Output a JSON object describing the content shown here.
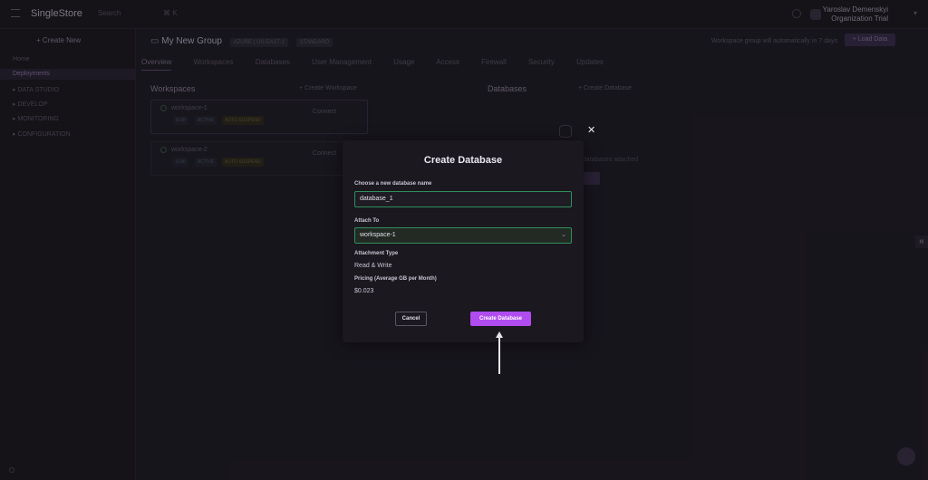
{
  "topbar": {
    "logo": "SingleStore",
    "search": "Search",
    "shortcut": "⌘ K",
    "user_name": "Yaroslav Demenskyi",
    "user_org": "Organization Trial"
  },
  "sidebar": {
    "create_new": "+ Create New",
    "items": [
      {
        "label": "Home"
      },
      {
        "label": "Deployments"
      },
      {
        "label": "▸ DATA STUDIO"
      },
      {
        "label": "▸ DEVELOP"
      },
      {
        "label": "▸ MONITORING"
      },
      {
        "label": "▸ CONFIGURATION"
      }
    ]
  },
  "main": {
    "group_title": "My New Group",
    "badges": [
      "AZURE | US-EAST-1",
      "STANDARD"
    ],
    "notice": "Workspace group will automatically in 7 days",
    "load_data": "+ Load Data",
    "tabs": [
      "Overview",
      "Workspaces",
      "Databases",
      "User Management",
      "Usage",
      "Access",
      "Firewall",
      "Security",
      "Updates"
    ],
    "workspaces_heading": "Workspaces",
    "create_workspace": "+ Create Workspace",
    "databases_heading": "Databases",
    "create_database_link": "+ Create Database",
    "workspace_cards": [
      {
        "name": "workspace-1",
        "chips": [
          "S-00",
          "ACTIVE",
          "AUTO-SUSPEND"
        ],
        "connect": "Connect"
      },
      {
        "name": "workspace-2",
        "chips": [
          "S-00",
          "ACTIVE",
          "AUTO-SUSPEND"
        ],
        "connect": "Connect"
      }
    ],
    "db_empty_text": "No databases attached"
  },
  "modal": {
    "title": "Create Database",
    "name_label": "Choose a new database name",
    "name_value": "database_1",
    "attach_label": "Attach To",
    "attach_value": "workspace-1",
    "type_label": "Attachment Type",
    "type_value": "Read & Write",
    "pricing_label": "Pricing (Average GB per Month)",
    "pricing_value": "$0.023",
    "cancel": "Cancel",
    "create": "Create Database",
    "close": "✕"
  },
  "colors": {
    "accent": "#b04cf0",
    "field_border": "#2f8f5b",
    "annotation_arrow": "#e8e6ea"
  }
}
